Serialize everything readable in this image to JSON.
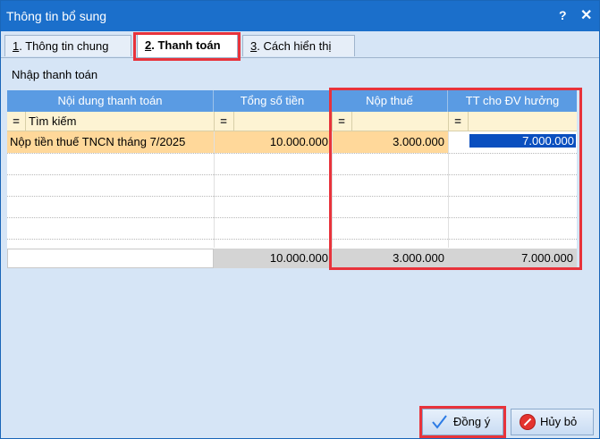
{
  "window": {
    "title": "Thông tin bổ sung",
    "help_glyph": "?",
    "close_glyph": "✕"
  },
  "tabs": [
    {
      "num": "1",
      "label": ". Thông tin chung"
    },
    {
      "num": "2",
      "label": ". Thanh toán"
    },
    {
      "num": "3",
      "label": ". Cách hiển thị"
    }
  ],
  "section": {
    "label": "Nhập thanh toán"
  },
  "grid": {
    "columns": [
      "Nội dung thanh toán",
      "Tổng số tiền",
      "Nộp thuế",
      "TT cho ĐV hưởng"
    ],
    "filter": {
      "eq_glyph": "=",
      "search_text": "Tìm kiếm"
    },
    "rows": [
      {
        "description": "Nộp tiền thuế TNCN tháng 7/2025",
        "total": "10.000.000",
        "tax": "3.000.000",
        "beneficiary": "7.000.000"
      }
    ],
    "totals": {
      "total": "10.000.000",
      "tax": "3.000.000",
      "beneficiary": "7.000.000"
    }
  },
  "buttons": {
    "ok": "Đồng ý",
    "cancel": "Hủy bỏ"
  },
  "colors": {
    "title_bar": "#1b6fcb",
    "header": "#5a9be3",
    "selected_row": "#ffd89a",
    "highlight_box": "#e8333b"
  }
}
